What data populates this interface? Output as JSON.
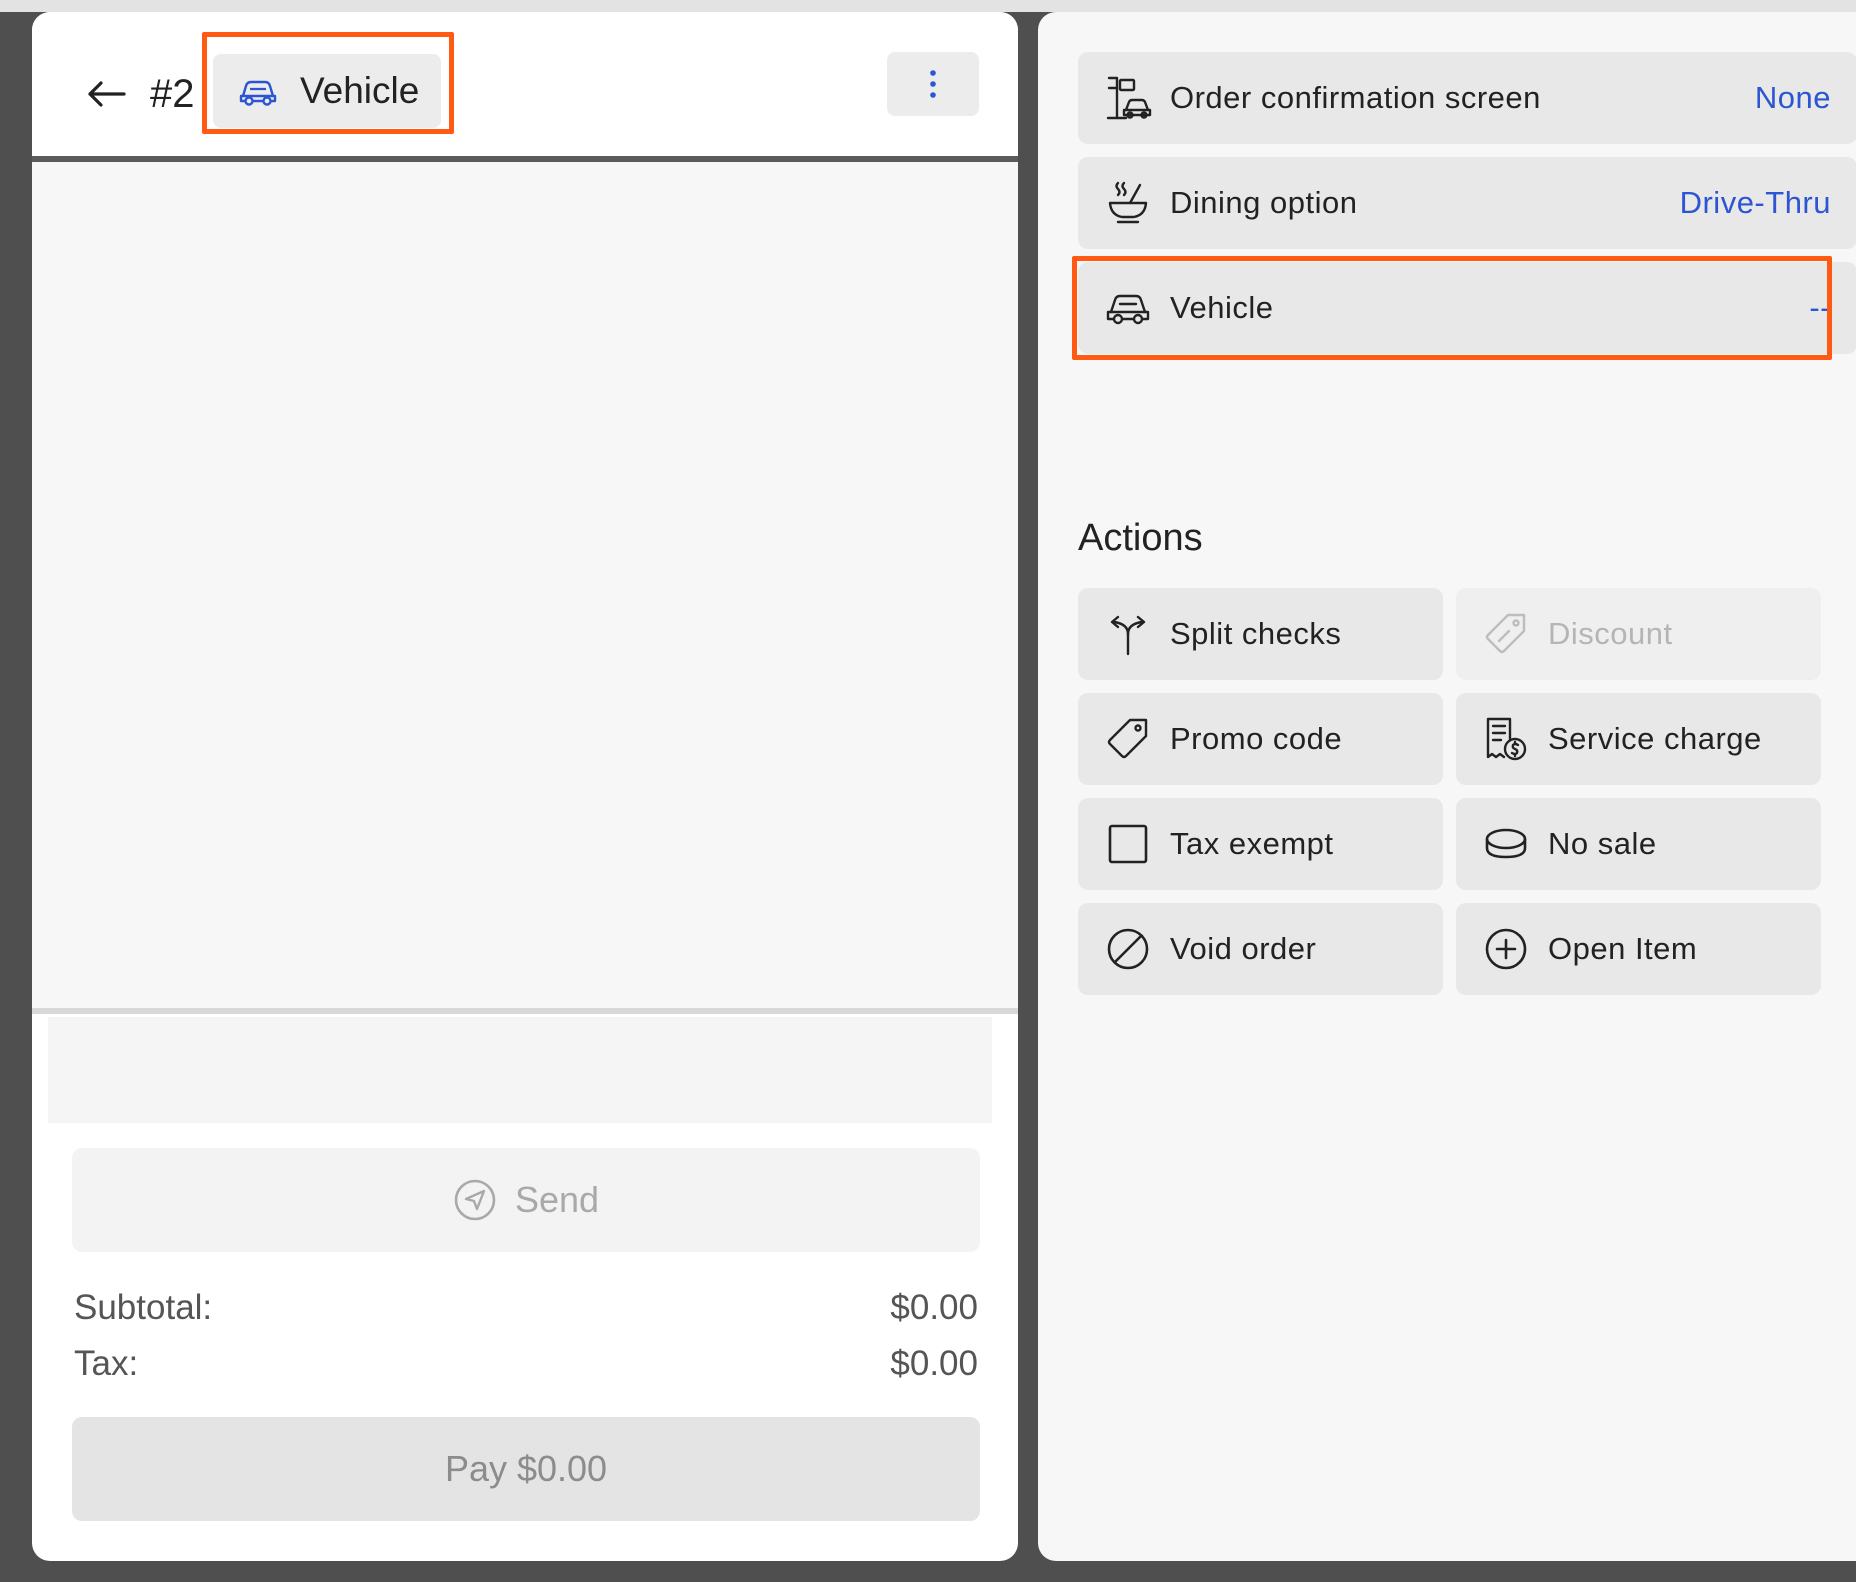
{
  "header": {
    "order_number": "#2",
    "chip_label": "Vehicle",
    "icons": {
      "back": "arrow-left-icon",
      "chip": "car-icon",
      "more": "more-vertical-icon"
    }
  },
  "order": {
    "send_label": "Send",
    "subtotal_label": "Subtotal:",
    "subtotal_value": "$0.00",
    "tax_label": "Tax:",
    "tax_value": "$0.00",
    "pay_label": "Pay $0.00"
  },
  "details": [
    {
      "label": "Order confirmation screen",
      "value": "None",
      "icon": "drive-thru-screen-icon"
    },
    {
      "label": "Dining option",
      "value": "Drive-Thru",
      "icon": "dining-bowl-icon"
    },
    {
      "label": "Vehicle",
      "value": "--",
      "icon": "car-icon"
    }
  ],
  "actions": {
    "title": "Actions",
    "items": [
      {
        "label": "Split checks",
        "icon": "split-arrows-icon",
        "enabled": true
      },
      {
        "label": "Discount",
        "icon": "discount-tag-icon",
        "enabled": false
      },
      {
        "label": "Promo code",
        "icon": "tag-icon",
        "enabled": true
      },
      {
        "label": "Service charge",
        "icon": "receipt-dollar-icon",
        "enabled": true
      },
      {
        "label": "Tax exempt",
        "icon": "checkbox-icon",
        "enabled": true
      },
      {
        "label": "No sale",
        "icon": "cash-drawer-icon",
        "enabled": true
      },
      {
        "label": "Void order",
        "icon": "void-circle-icon",
        "enabled": true
      },
      {
        "label": "Open Item",
        "icon": "plus-circle-icon",
        "enabled": true
      }
    ]
  },
  "colors": {
    "accent_blue": "#2c55d4",
    "highlight": "#ff5a14",
    "panel_bg": "#f7f7f7",
    "button_bg": "#e8e8e8"
  }
}
